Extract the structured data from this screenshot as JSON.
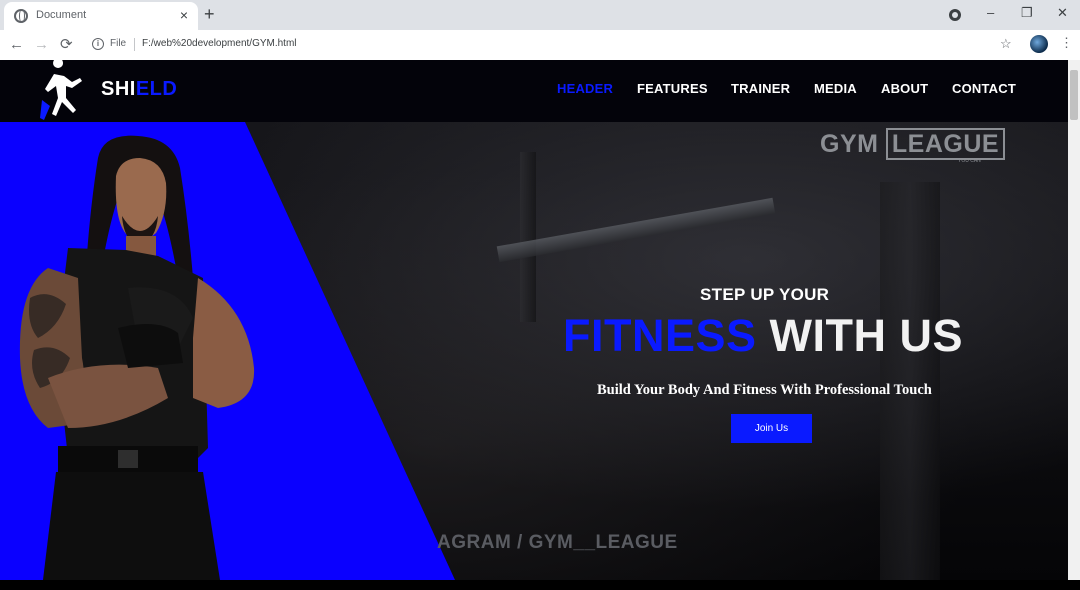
{
  "browser": {
    "tab_title": "Document",
    "tab_close": "×",
    "new_tab": "+",
    "address": {
      "file_label": "File",
      "url": "F:/web%20development/GYM.html"
    },
    "window_controls": {
      "minimize": "–",
      "restore": "❐",
      "close": "✕"
    }
  },
  "site": {
    "logo": {
      "part1": "SHI",
      "part2": "ELD"
    },
    "nav": [
      {
        "label": "HEADER",
        "active": true
      },
      {
        "label": "FEATURES",
        "active": false
      },
      {
        "label": "TRAINER",
        "active": false
      },
      {
        "label": "MEDIA",
        "active": false
      },
      {
        "label": "ABOUT",
        "active": false
      },
      {
        "label": "CONTACT",
        "active": false
      }
    ],
    "hero": {
      "watermark_left": "GYM",
      "watermark_right": "LEAGUE",
      "watermark_sub": "YOU CAN",
      "eyebrow": "STEP UP YOUR",
      "headline_blue": "FITNESS",
      "headline_white": "WITH US",
      "subline": "Build Your Body And Fitness With Professional Touch",
      "cta": "Join Us",
      "instagram": "AGRAM / GYM__LEAGUE"
    }
  },
  "colors": {
    "brand_blue": "#0a1aff",
    "nav_bg": "#03030a",
    "text_white": "#ffffff"
  }
}
